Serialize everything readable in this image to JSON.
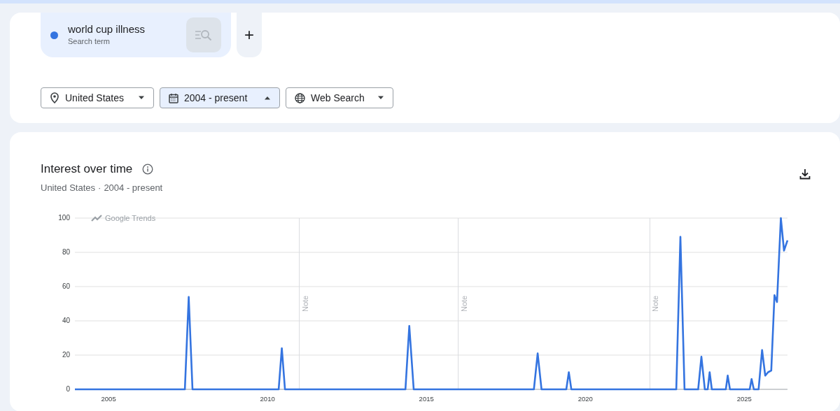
{
  "search_terms": [
    {
      "term": "world cup illness",
      "subtitle": "Search term",
      "color": "#3474e0"
    }
  ],
  "add_button": "+",
  "filters": [
    {
      "kind": "location",
      "label": "United States",
      "expanded": false
    },
    {
      "kind": "date",
      "label": "2004 - present",
      "expanded": true
    },
    {
      "kind": "property",
      "label": "Web Search",
      "expanded": false
    }
  ],
  "chart_panel": {
    "title": "Interest over time",
    "subtitle": [
      "United States",
      "·",
      "2004 - present"
    ],
    "brand_label": "Google Trends",
    "chart_data": {
      "type": "line",
      "x": [
        2003.94,
        2007.4,
        2007.52,
        2007.64,
        2010.35,
        2010.45,
        2010.55,
        2014.34,
        2014.46,
        2014.6,
        2018.38,
        2018.5,
        2018.62,
        2019.4,
        2019.48,
        2019.56,
        2022.86,
        2022.99,
        2023.12,
        2023.55,
        2023.65,
        2023.76,
        2023.85,
        2023.91,
        2023.98,
        2024.42,
        2024.48,
        2024.55,
        2025.17,
        2025.23,
        2025.3,
        2025.45,
        2025.56,
        2025.66,
        2025.75,
        2025.85,
        2025.95,
        2026.03,
        2026.15,
        2026.25,
        2026.36
      ],
      "series": [
        {
          "color": "#3474e0",
          "values": [
            0,
            0,
            54,
            0,
            0,
            24,
            0,
            0,
            37,
            0,
            0,
            21,
            0,
            0,
            10,
            0,
            0,
            89,
            0,
            0,
            19,
            0,
            0,
            10,
            0,
            0,
            8,
            0,
            0,
            6,
            0,
            0,
            23,
            8,
            10,
            11,
            55,
            51,
            100,
            81,
            87
          ]
        }
      ],
      "xlim": [
        2003.94,
        2026.36
      ],
      "ylim": [
        0,
        100
      ],
      "xticks": [
        2005,
        2010,
        2015,
        2020,
        2025
      ],
      "yticks": [
        0,
        20,
        40,
        60,
        80,
        100
      ],
      "grid": true,
      "ref_lines": [
        {
          "axis": "x",
          "value": 2011,
          "label": "Note"
        },
        {
          "axis": "x",
          "value": 2016,
          "label": "Note"
        },
        {
          "axis": "x",
          "value": 2022.03,
          "label": "Note"
        }
      ]
    }
  }
}
